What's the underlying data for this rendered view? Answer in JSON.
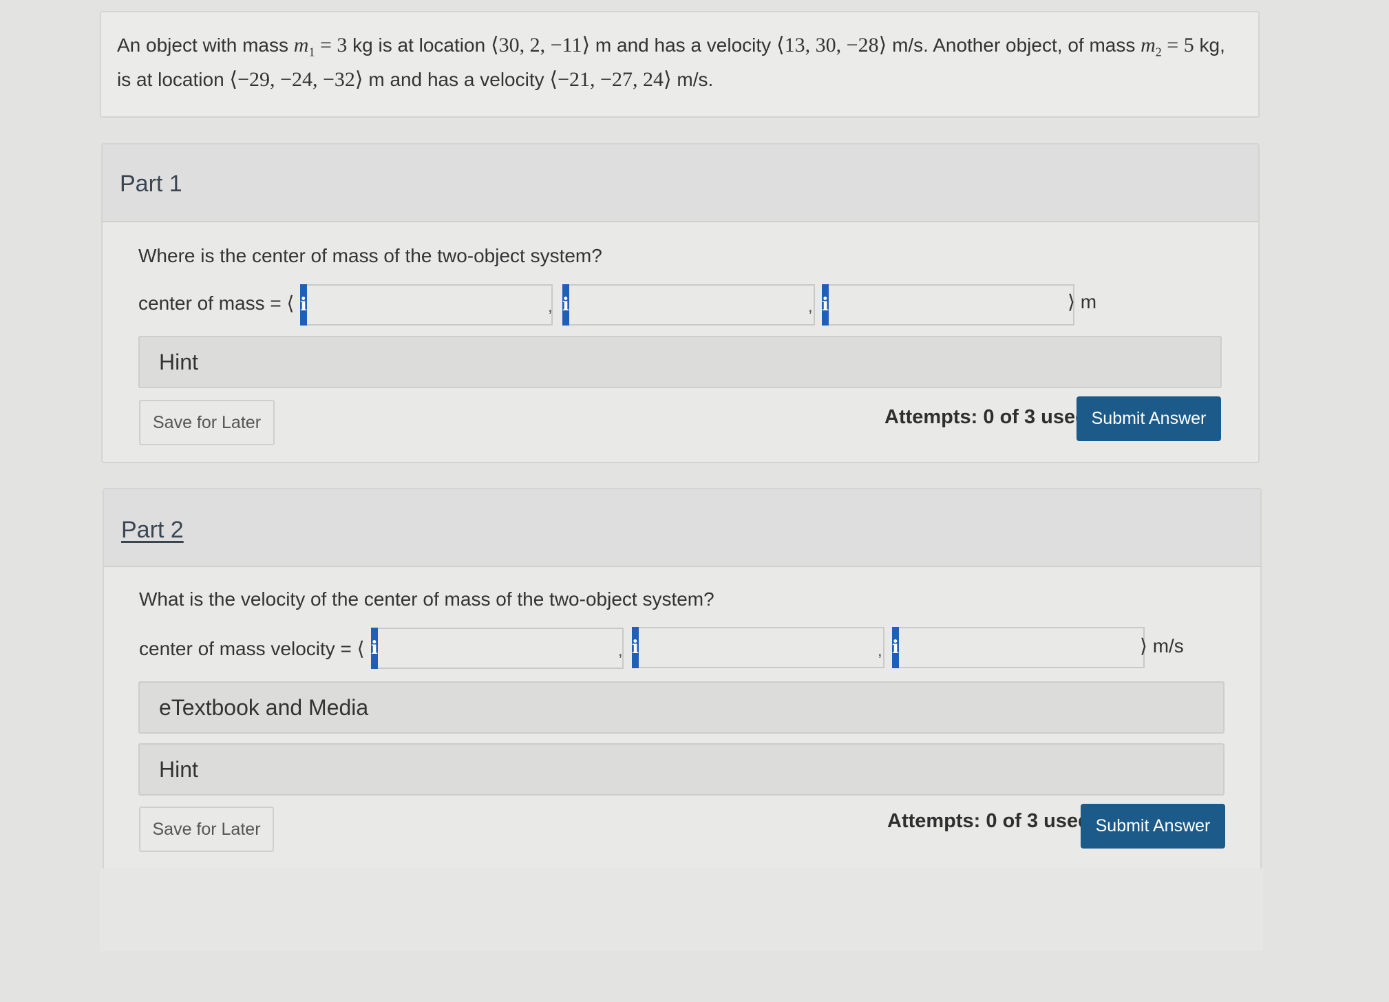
{
  "problem": {
    "t1": "An object with mass ",
    "m1_sym": "m",
    "m1_sub": "1",
    "eq1": " = ",
    "m1_val": "3",
    "t2": " kg is at location ",
    "pos1": "⟨30, 2, −11⟩",
    "t3": " m and has a velocity ",
    "vel1": "⟨13, 30, −28⟩",
    "t4": " m/s. Another object, of mass ",
    "m2_sym": "m",
    "m2_sub": "2",
    "eq2": " = ",
    "m2_val": "5",
    "t5": " kg,",
    "t6": "is at location ",
    "pos2": "⟨−29, −24, −32⟩",
    "t7": " m and has a velocity ",
    "vel2": "⟨−21, −27, 24⟩",
    "t8": " m/s."
  },
  "part1": {
    "title": "Part 1",
    "question": "Where is the center of mass of the two-object system?",
    "label": "center of mass = ⟨",
    "info_glyph": "i",
    "comma": ",",
    "unit": "⟩ m",
    "inputs": [
      "",
      "",
      ""
    ],
    "hint": "Hint",
    "save": "Save for Later",
    "attempts": "Attempts: 0 of 3 used",
    "submit": "Submit Answer"
  },
  "part2": {
    "title": "Part 2",
    "question": "What is the velocity of the center of mass of the two-object system?",
    "label": "center of mass velocity = ⟨",
    "info_glyph": "i",
    "comma": ",",
    "unit": "⟩ m/s",
    "inputs": [
      "",
      "",
      ""
    ],
    "etextbook": "eTextbook and Media",
    "hint": "Hint",
    "save": "Save for Later",
    "attempts": "Attempts: 0 of 3 used",
    "submit": "Submit Answer"
  },
  "colors": {
    "info_button": "#1f5fb8",
    "submit_button": "#1c5a8a",
    "page_bg": "#e3e3e1"
  },
  "icons": {
    "info": "info-icon"
  }
}
